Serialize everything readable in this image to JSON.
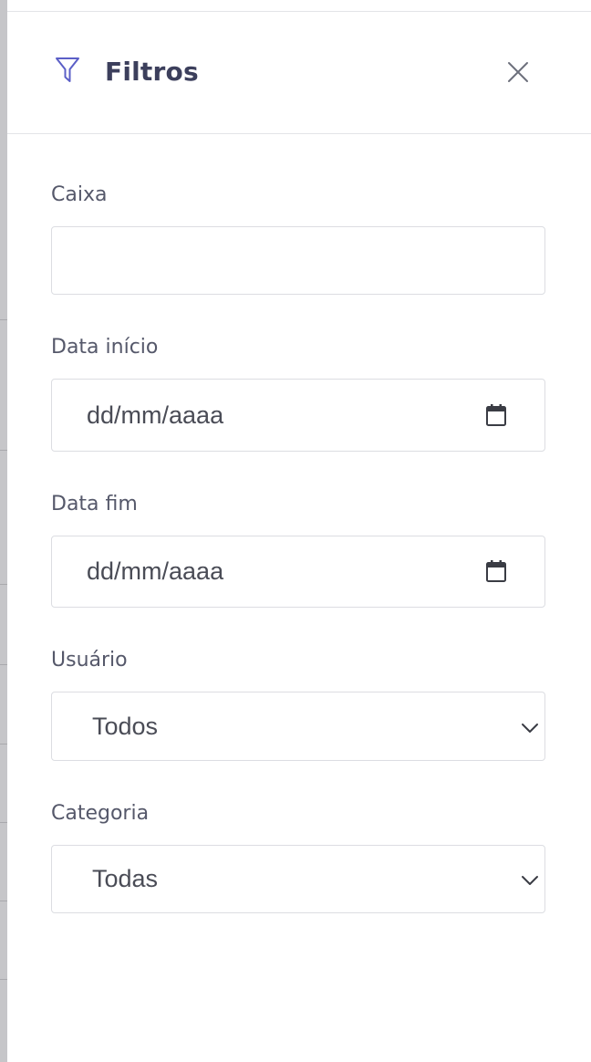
{
  "drawer": {
    "title": "Filtros",
    "icons": {
      "filter": "filter-funnel-icon",
      "close": "close-x-icon"
    },
    "colors": {
      "accent": "#5b5fc7",
      "title": "#3c3f5c",
      "label": "#55586a",
      "border": "#dcdde2"
    }
  },
  "fields": {
    "caixa": {
      "label": "Caixa",
      "value": ""
    },
    "data_inicio": {
      "label": "Data início",
      "placeholder": "dd/mm/aaaa",
      "icon": "calendar-icon"
    },
    "data_fim": {
      "label": "Data fim",
      "placeholder": "dd/mm/aaaa",
      "icon": "calendar-icon"
    },
    "usuario": {
      "label": "Usuário",
      "selected": "Todos",
      "icon": "chevron-down-icon"
    },
    "categoria": {
      "label": "Categoria",
      "selected": "Todas",
      "icon": "chevron-down-icon"
    }
  }
}
